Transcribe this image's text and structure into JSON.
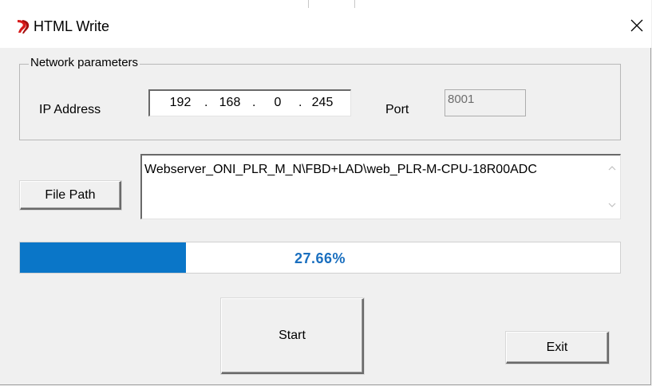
{
  "window": {
    "title": "HTML Write",
    "close_glyph": "✕"
  },
  "network": {
    "group_label": "Network parameters",
    "ip_label": "IP Address",
    "ip_octets": [
      "192",
      "168",
      "0",
      "245"
    ],
    "ip_separator": ".",
    "port_label": "Port",
    "port_value": "8001"
  },
  "file": {
    "button_label": "File Path",
    "path_value": "Webserver_ONI_PLR_M_N\\FBD+LAD\\web_PLR-M-CPU-18R00ADC"
  },
  "progress": {
    "percent": 27.66,
    "label": "27.66%",
    "color": "#0a76c8"
  },
  "buttons": {
    "start_label": "Start",
    "exit_label": "Exit"
  },
  "icons": {
    "app": "app-logo-icon",
    "close": "close-icon",
    "scroll_up": "chevron-up-icon",
    "scroll_down": "chevron-down-icon"
  }
}
